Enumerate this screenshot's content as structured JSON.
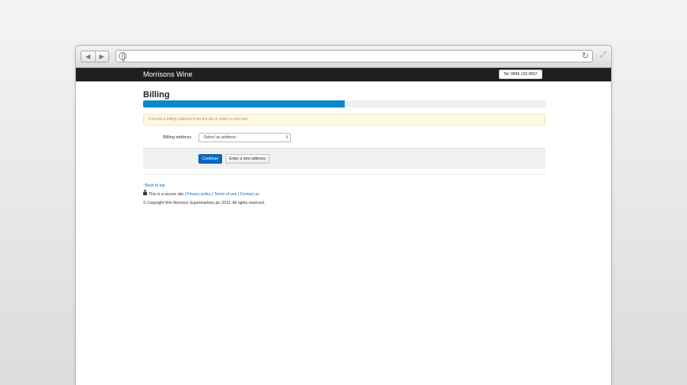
{
  "browser": {
    "back_glyph": "◀",
    "forward_glyph": "▶",
    "reload_glyph": "↻",
    "expand_glyph": "⤢",
    "url": ""
  },
  "site": {
    "brand": "Morrisons Wine",
    "tel": "Tel: 0845 123 4567"
  },
  "page": {
    "title": "Billing",
    "progress_fraction": 0.5,
    "alert": "Choose a billing address from the list or enter a new one.",
    "billing_label": "Billing address",
    "select_value": "- Select an address -",
    "continue_label": "Continue",
    "new_address_label": "Enter a new address"
  },
  "footer": {
    "back_to_top": "Back to top",
    "secure_text": "This is a secure site |",
    "privacy": "Privacy policy",
    "sep1": "|",
    "terms": "Terms of use",
    "sep2": "|",
    "contact": "Contact us",
    "copyright": "© Copyright Wm Morrison Supermarkets plc 2012. All rights reserved."
  },
  "colors": {
    "primary": "#0b68c4",
    "progress": "#0d87cc",
    "navbar": "#1f1f1f",
    "alert_bg": "#fcf8e3",
    "alert_text": "#c09853"
  }
}
